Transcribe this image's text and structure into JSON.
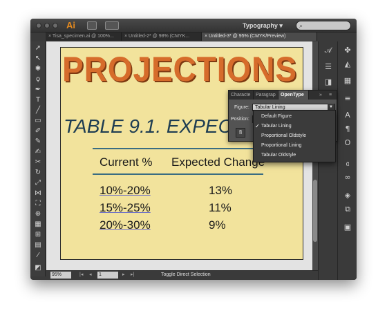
{
  "app": {
    "logo": "Ai",
    "workspace": "Typography",
    "search_placeholder": "⌕"
  },
  "tabs": [
    {
      "label": "Tisa_specimen.ai @ 100%...",
      "close": "×",
      "active": false
    },
    {
      "label": "Untitled-2* @ 98% (CMYK...",
      "close": "×",
      "active": false
    },
    {
      "label": "Untitled-3* @ 95% (CMYK/Preview)",
      "close": "×",
      "active": true
    }
  ],
  "artboard": {
    "headline": "PROJECTIONS",
    "table_title": "TABLE 9.1. EXPECTED",
    "headers": [
      "Current %",
      "Expected Change"
    ],
    "rows": [
      {
        "current": "10%-20%",
        "change": "13%"
      },
      {
        "current": "15%-25%",
        "change": "11%"
      },
      {
        "current": "20%-30%",
        "change": "9%"
      }
    ],
    "colors": {
      "background": "#f2e39c",
      "headline": "#d66c2b",
      "rule": "#3a6d82",
      "title": "#1e3d52"
    }
  },
  "status": {
    "zoom": "95%",
    "page": "1",
    "text": "Toggle Direct Selection"
  },
  "char_panel": {
    "tabs": [
      "Characte",
      "Paragrap",
      "OpenType"
    ],
    "active_tab": "OpenType",
    "figure_label": "Figure:",
    "figure_value": "Tabular Lining",
    "position_label": "Position:",
    "ligature_button": "fi"
  },
  "figure_options": [
    {
      "label": "Default Figure",
      "checked": false
    },
    {
      "label": "Tabular Lining",
      "checked": true
    },
    {
      "label": "Proportional Oldstyle",
      "checked": false
    },
    {
      "label": "Proportional Lining",
      "checked": false
    },
    {
      "label": "Tabular Oldstyle",
      "checked": false
    }
  ],
  "icons": {
    "tools": [
      "selection-tool-icon",
      "direct-selection-tool-icon",
      "magic-wand-tool-icon",
      "lasso-tool-icon",
      "pen-tool-icon",
      "type-tool-icon",
      "line-tool-icon",
      "rectangle-tool-icon",
      "paintbrush-tool-icon",
      "pencil-tool-icon",
      "blob-brush-tool-icon",
      "eraser-tool-icon",
      "rotate-tool-icon",
      "scale-tool-icon",
      "width-tool-icon",
      "free-transform-tool-icon",
      "shape-builder-tool-icon",
      "perspective-grid-tool-icon",
      "mesh-tool-icon",
      "gradient-tool-icon",
      "eyedropper-tool-icon"
    ],
    "dock": [
      "character-styles-icon",
      "appearance-icon",
      "color-guide-icon",
      "swatches-icon",
      "stroke-icon",
      "gradient-icon",
      "character-icon",
      "paragraph-icon",
      "opentype-icon",
      "glyphs-icon",
      "layers-icon",
      "artboards-icon",
      "links-icon"
    ]
  }
}
